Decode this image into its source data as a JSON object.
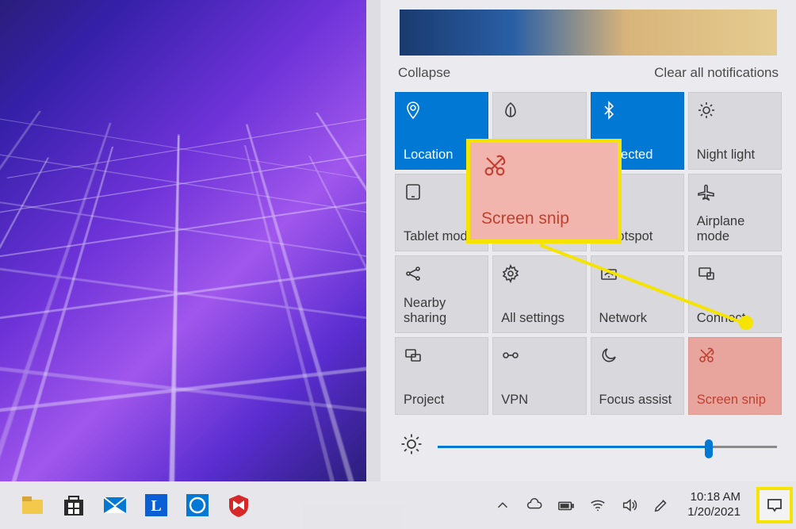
{
  "action_center": {
    "collapse": "Collapse",
    "clear": "Clear all notifications",
    "tiles": [
      {
        "label": "Location",
        "icon": "location",
        "state": "active"
      },
      {
        "label": "",
        "icon": "leaf",
        "state": ""
      },
      {
        "label": "onnected",
        "icon": "bluetooth",
        "state": "active"
      },
      {
        "label": "Night light",
        "icon": "sun",
        "state": ""
      },
      {
        "label": "Tablet mode",
        "icon": "tablet",
        "state": ""
      },
      {
        "label": "",
        "icon": "",
        "state": ""
      },
      {
        "label": "e hotspot",
        "icon": "hotspot",
        "state": ""
      },
      {
        "label": "Airplane mode",
        "icon": "airplane",
        "state": ""
      },
      {
        "label": "Nearby sharing",
        "icon": "share",
        "state": ""
      },
      {
        "label": "All settings",
        "icon": "gear",
        "state": ""
      },
      {
        "label": "Network",
        "icon": "wifi",
        "state": ""
      },
      {
        "label": "Connect",
        "icon": "connect",
        "state": ""
      },
      {
        "label": "Project",
        "icon": "project",
        "state": ""
      },
      {
        "label": "VPN",
        "icon": "vpn",
        "state": ""
      },
      {
        "label": "Focus assist",
        "icon": "moon",
        "state": ""
      },
      {
        "label": "Screen snip",
        "icon": "snip",
        "state": "snip"
      }
    ],
    "brightness_percent": 80
  },
  "callout": {
    "label": "Screen snip"
  },
  "taskbar": {
    "time": "10:18 AM",
    "date": "1/20/2021"
  }
}
